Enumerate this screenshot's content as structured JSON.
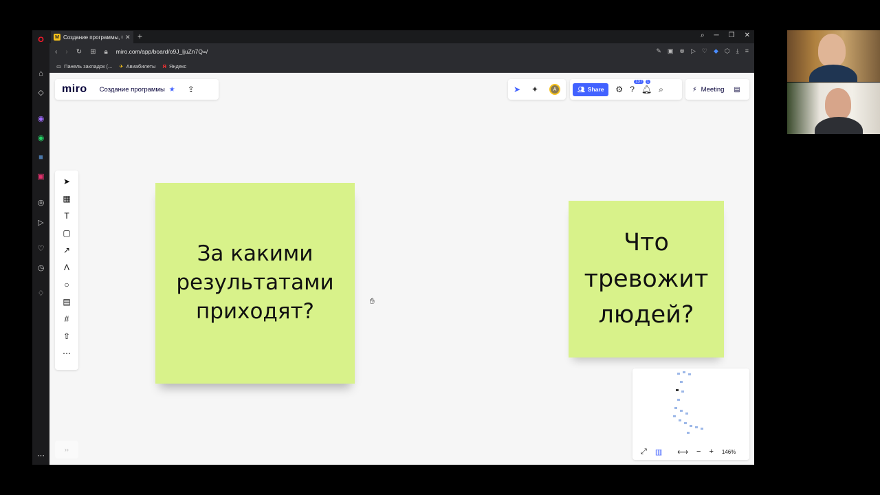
{
  "browser": {
    "tab_title": "Создание программы, Он",
    "tab_favicon_letter": "M",
    "url": "miro.com/app/board/o9J_ljuZn7Q=/",
    "bookmarks": [
      "Панель закладок (...",
      "Авиабилеты",
      "Яндекс"
    ]
  },
  "miro": {
    "logo": "miro",
    "board_name": "Создание программы",
    "share_label": "Share",
    "help_badge": "137",
    "notifications_badge": "1",
    "meeting_label": "Meeting",
    "avatar_initial": "А",
    "zoom_level": "146%",
    "expand_hint": "››"
  },
  "stickies": [
    {
      "text": "За какими\nрезультатами\nприходят?",
      "color": "#d8f28a"
    },
    {
      "text": "Что\nтревожит\nлюдей?",
      "color": "#d8f28a"
    }
  ],
  "colors": {
    "accent": "#4262ff",
    "sticky": "#d8f28a",
    "canvas": "#f6f6f6"
  },
  "icons": {
    "toolbar": [
      "select-icon",
      "templates-icon",
      "text-icon",
      "sticky-note-icon",
      "connector-icon",
      "pen-icon",
      "shape-icon",
      "comment-icon",
      "frame-icon",
      "upload-icon",
      "more-icon"
    ]
  }
}
